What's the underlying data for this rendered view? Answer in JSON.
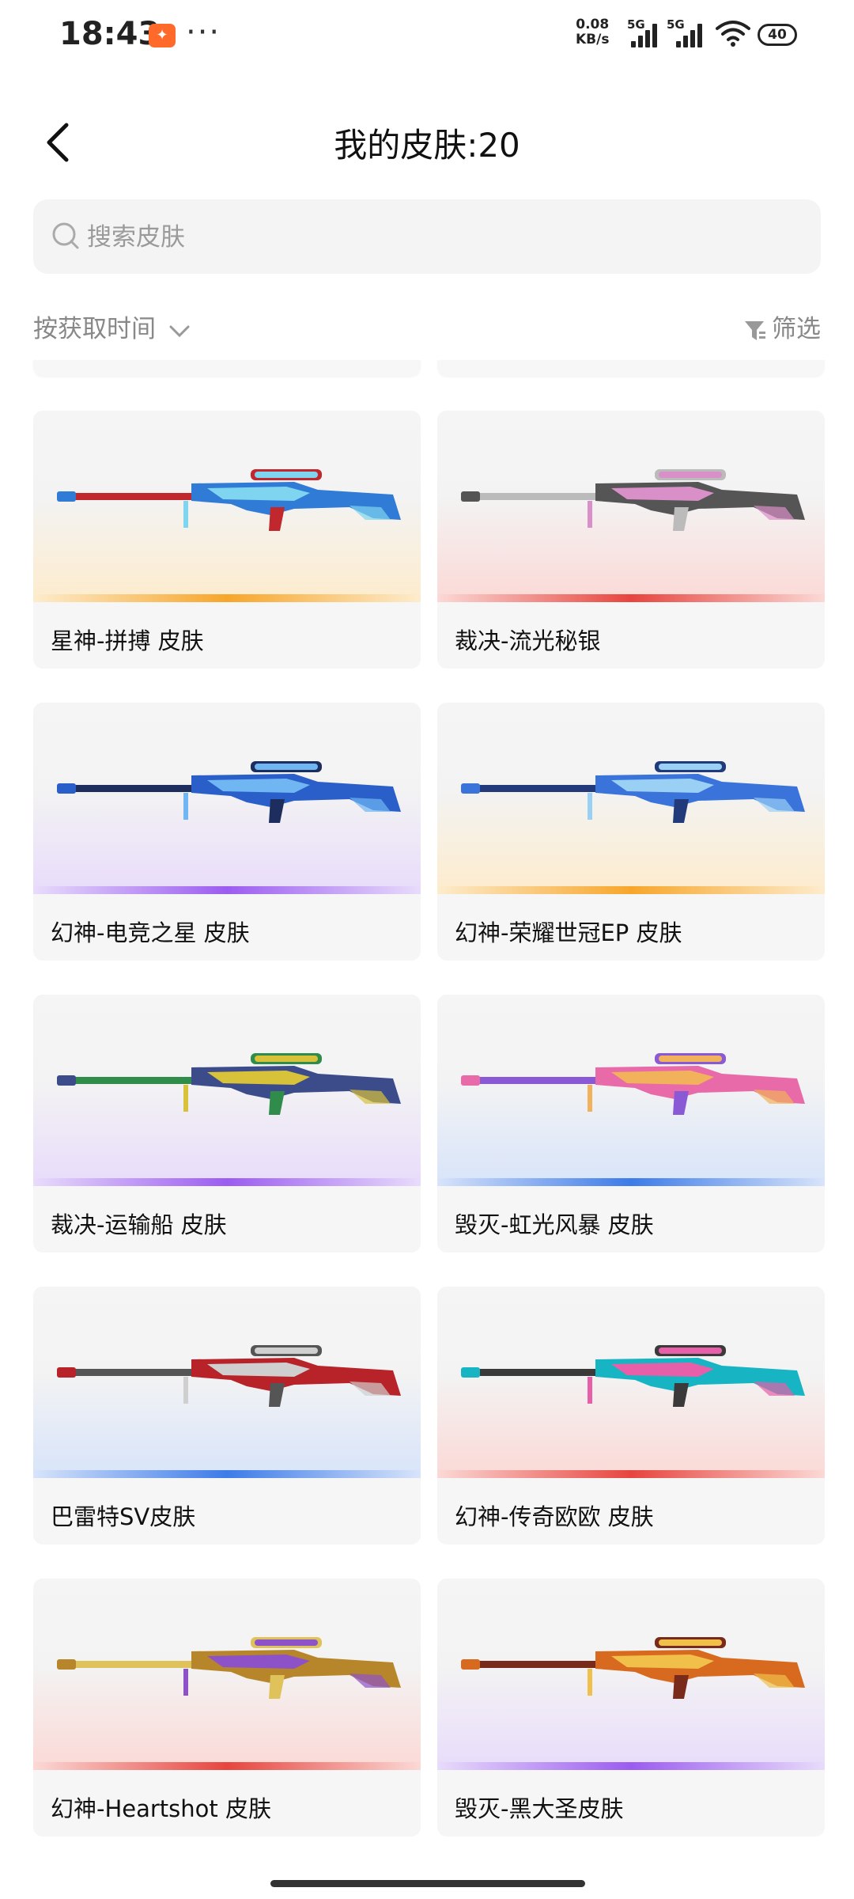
{
  "status_bar": {
    "time": "18:43",
    "speed_value": "0.08",
    "speed_unit": "KB/s",
    "net1": "5G",
    "net2": "5G",
    "battery": "40"
  },
  "header": {
    "title": "我的皮肤:20"
  },
  "search": {
    "placeholder": "搜索皮肤"
  },
  "sort": {
    "label": "按获取时间"
  },
  "filter": {
    "label": "筛选"
  },
  "skins": [
    {
      "name": "星神-拼搏 皮肤",
      "tone": "orange",
      "gun": [
        "#2f7bd6",
        "#7fd4f0",
        "#c0282d"
      ]
    },
    {
      "name": "裁决-流光秘银",
      "tone": "red",
      "gun": [
        "#555",
        "#d98fc7",
        "#bbb"
      ]
    },
    {
      "name": "幻神-电竞之星 皮肤",
      "tone": "purple",
      "gun": [
        "#2a5fc9",
        "#6fb6f2",
        "#1d2e5e"
      ]
    },
    {
      "name": "幻神-荣耀世冠EP 皮肤",
      "tone": "orange",
      "gun": [
        "#3a73d9",
        "#9bd0f5",
        "#223a7a"
      ]
    },
    {
      "name": "裁决-运输船 皮肤",
      "tone": "purple",
      "gun": [
        "#3c4c8a",
        "#d7c23a",
        "#2f8c4a"
      ]
    },
    {
      "name": "毁灭-虹光风暴 皮肤",
      "tone": "blue",
      "gun": [
        "#e86aa8",
        "#f2b25c",
        "#8a5ad6"
      ]
    },
    {
      "name": "巴雷特SV皮肤",
      "tone": "blue",
      "gun": [
        "#b8232a",
        "#cfcfcf",
        "#555"
      ]
    },
    {
      "name": "幻神-传奇欧欧 皮肤",
      "tone": "red",
      "gun": [
        "#17b4c4",
        "#e75fa8",
        "#3a3a3a"
      ]
    },
    {
      "name": "幻神-Heartshot 皮肤",
      "tone": "red",
      "gun": [
        "#b8862a",
        "#8d52c7",
        "#e0c25a"
      ]
    },
    {
      "name": "毁灭-黑大圣皮肤",
      "tone": "purple",
      "gun": [
        "#d86a1f",
        "#f1c04a",
        "#7a2a1a"
      ]
    }
  ],
  "colors": {
    "orange": "#f7a62b",
    "red": "#e7453f",
    "purple": "#9b5cf0",
    "blue": "#3d7be8",
    "orange_fade": "#fdeccd",
    "red_fade": "#fbd9d6",
    "purple_fade": "#e8dcfb",
    "blue_fade": "#d8e4fa"
  }
}
